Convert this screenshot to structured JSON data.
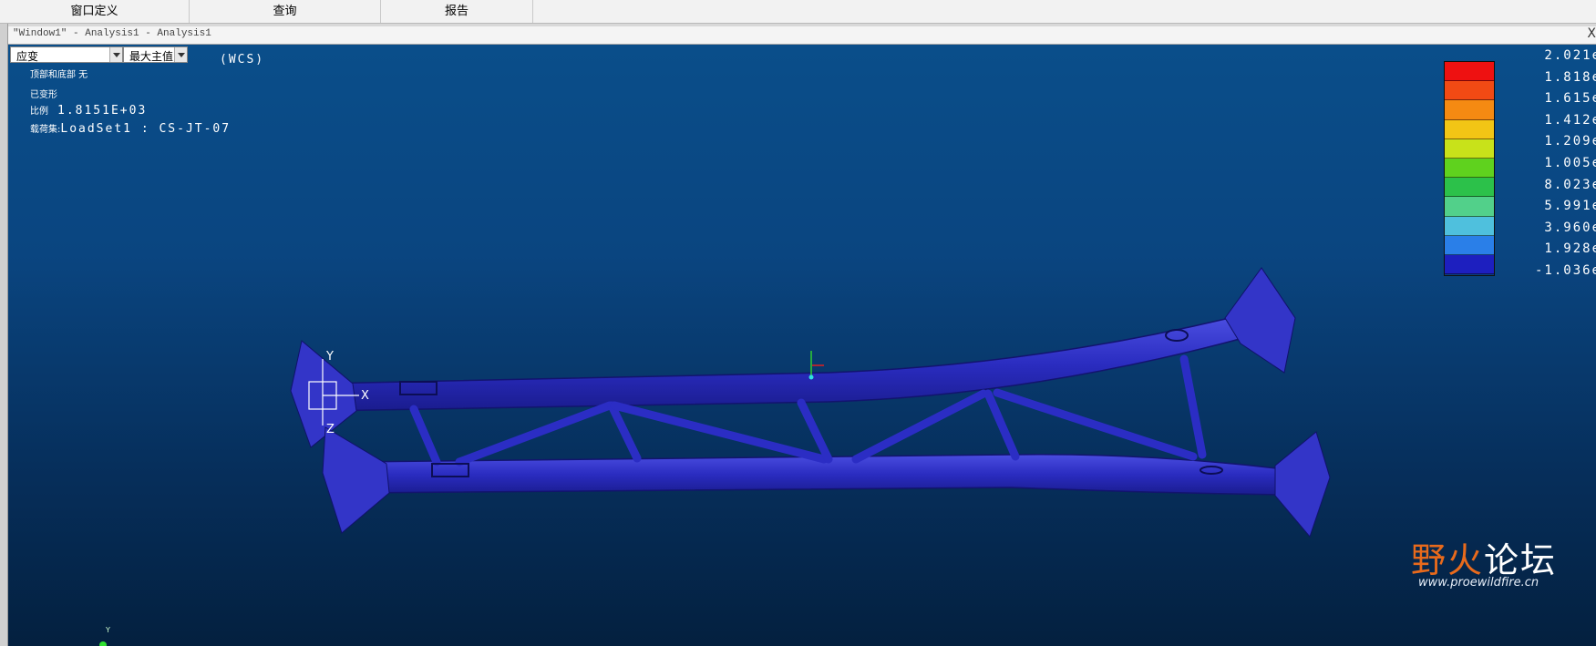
{
  "menu": {
    "items": [
      {
        "label": "窗口定义"
      },
      {
        "label": "查询"
      },
      {
        "label": "报告"
      }
    ]
  },
  "window": {
    "title": "\"Window1\" - Analysis1 - Analysis1",
    "close_glyph": "X"
  },
  "controls": {
    "quantity": "应变",
    "component": "最大主值",
    "coord_system": "(WCS)"
  },
  "info": {
    "display_mode": "顶部和底部 无",
    "deformed": "已变形",
    "scale_label": "比例",
    "scale_value": "1.8151E+03",
    "loadset_label": "载荷集:",
    "loadset_value": "LoadSet1 :  CS-JT-07"
  },
  "legend": {
    "values": [
      "2.021e",
      "1.818e",
      "1.615e",
      "1.412e",
      "1.209e",
      "1.005e",
      "8.023e",
      "5.991e",
      "3.960e",
      "1.928e",
      "-1.036e"
    ],
    "colors": [
      "#ee1111",
      "#f24a14",
      "#f58a12",
      "#f2c515",
      "#c8e21a",
      "#5fd21e",
      "#2cc14a",
      "#52d08a",
      "#4fc0dd",
      "#2a7fe8",
      "#1d1fbf"
    ]
  },
  "triad": {
    "y": "Y",
    "x": "X",
    "z": "Z"
  },
  "corner_axis": {
    "y": "Y"
  },
  "watermark": {
    "text_left": "野火",
    "text_right": "论坛",
    "url": "www.proewildfire.cn"
  }
}
